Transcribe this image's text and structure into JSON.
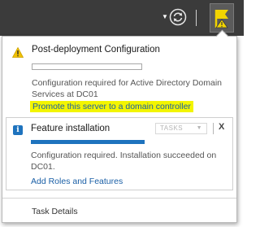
{
  "toolbar": {
    "dropdown_icon": "caret-down-icon",
    "refresh_icon": "refresh-icon",
    "flag_icon": "notification-flag-icon",
    "flag_warning_color": "#f2d400"
  },
  "notifications": [
    {
      "icon": "warning-icon",
      "title": "Post-deployment Configuration",
      "progress": 0,
      "description": "Configuration required for Active Directory Domain Services at DC01",
      "link": "Promote this server to a domain controller",
      "link_highlight_color": "#f3f500"
    },
    {
      "icon": "info-icon",
      "icon_glyph": "i",
      "title": "Feature installation",
      "tasks_label": "TASKS",
      "close_label": "X",
      "progress": 1,
      "progress_color": "#1e73be",
      "description": "Configuration required. Installation succeeded on DC01.",
      "link": "Add Roles and Features"
    }
  ],
  "footer": {
    "task_details": "Task Details"
  }
}
